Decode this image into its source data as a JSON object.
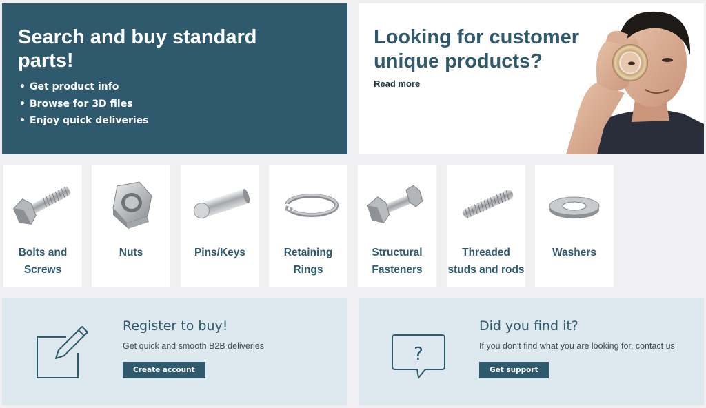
{
  "hero_left": {
    "title": "Search and buy standard parts!",
    "bullets": [
      "Get product info",
      "Browse for 3D files",
      "Enjoy quick deliveries"
    ]
  },
  "hero_right": {
    "title": "Looking for customer unique products?",
    "link": "Read more"
  },
  "categories": [
    {
      "label_line1": "Bolts and",
      "label_line2": "Screws",
      "icon": "bolt-icon"
    },
    {
      "label_line1": "Nuts",
      "label_line2": "",
      "icon": "nut-icon"
    },
    {
      "label_line1": "Pins/Keys",
      "label_line2": "",
      "icon": "pin-icon"
    },
    {
      "label_line1": "Retaining",
      "label_line2": "Rings",
      "icon": "retaining-ring-icon"
    },
    {
      "label_line1": "Structural",
      "label_line2": "Fasteners",
      "icon": "structural-fastener-icon"
    },
    {
      "label_line1": "Threaded",
      "label_line2": "studs and rods",
      "icon": "threaded-rod-icon"
    },
    {
      "label_line1": "Washers",
      "label_line2": "",
      "icon": "washer-icon"
    }
  ],
  "register": {
    "title": "Register to buy!",
    "text": "Get quick and smooth B2B deliveries",
    "button": "Create account",
    "icon": "edit-icon"
  },
  "support": {
    "title": "Did you find it?",
    "text": "If you don't find what you are looking for, contact us",
    "button": "Get support",
    "icon": "question-bubble-icon",
    "icon_glyph": "?"
  },
  "colors": {
    "brand": "#2f5a6d",
    "panel_bg": "#dde9ee",
    "page_bg": "#f0f0f3"
  }
}
